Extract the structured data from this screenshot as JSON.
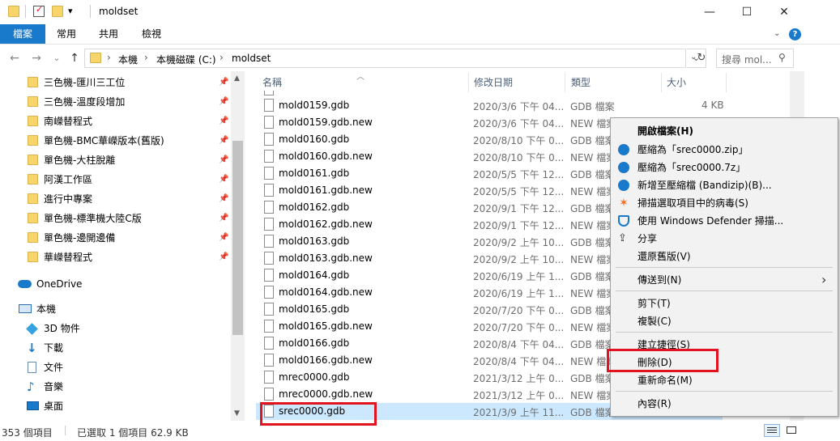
{
  "titlebar": {
    "title": "moldset",
    "qat_dropdown": "▾",
    "minimize": "—",
    "maximize": "☐",
    "close": "✕"
  },
  "ribbon": {
    "tabs": [
      "檔案",
      "常用",
      "共用",
      "檢視"
    ],
    "help": "?"
  },
  "nav": {
    "back": "←",
    "forward": "→",
    "recent": "⌄",
    "up": "↑",
    "breadcrumb": [
      "本機",
      "本機磁碟 (C:)",
      "moldset"
    ],
    "search_placeholder": "搜尋 mol...",
    "refresh": "↻"
  },
  "sidebar": {
    "quick_access": [
      "三色機-匯川三工位",
      "三色機-溫度段增加",
      "南嶸替程式",
      "單色機-BMC華嶸版本(舊版)",
      "單色機-大柱脫離",
      "阿漢工作區",
      "進行中專案",
      "單色機-標準機大陸C版",
      "單色機-邊開邊備",
      "華嶸替程式"
    ],
    "onedrive": "OneDrive",
    "this_pc": "本機",
    "pc_items": [
      "3D 物件",
      "下載",
      "文件",
      "音樂",
      "桌面"
    ]
  },
  "columns": {
    "name": "名稱",
    "date": "修改日期",
    "type": "類型",
    "size": "大小"
  },
  "files": [
    {
      "name": "mold0159.gdb",
      "date": "2020/3/6 下午 04...",
      "type": "GDB 檔案",
      "size": "4 KB"
    },
    {
      "name": "mold0159.gdb.new",
      "date": "2020/3/6 下午 04...",
      "type": "NEW 檔案",
      "size": ""
    },
    {
      "name": "mold0160.gdb",
      "date": "2020/8/10 下午 0...",
      "type": "GDB 檔案",
      "size": ""
    },
    {
      "name": "mold0160.gdb.new",
      "date": "2020/8/10 下午 0...",
      "type": "NEW 檔案",
      "size": ""
    },
    {
      "name": "mold0161.gdb",
      "date": "2020/5/5 下午 12...",
      "type": "GDB 檔案",
      "size": ""
    },
    {
      "name": "mold0161.gdb.new",
      "date": "2020/5/5 下午 12...",
      "type": "NEW 檔案",
      "size": ""
    },
    {
      "name": "mold0162.gdb",
      "date": "2020/9/1 下午 12...",
      "type": "GDB 檔案",
      "size": ""
    },
    {
      "name": "mold0162.gdb.new",
      "date": "2020/9/1 下午 12...",
      "type": "NEW 檔案",
      "size": ""
    },
    {
      "name": "mold0163.gdb",
      "date": "2020/9/2 上午 10...",
      "type": "GDB 檔案",
      "size": ""
    },
    {
      "name": "mold0163.gdb.new",
      "date": "2020/9/2 上午 10...",
      "type": "NEW 檔案",
      "size": ""
    },
    {
      "name": "mold0164.gdb",
      "date": "2020/6/19 上午 1...",
      "type": "GDB 檔案",
      "size": ""
    },
    {
      "name": "mold0164.gdb.new",
      "date": "2020/6/19 上午 1...",
      "type": "NEW 檔案",
      "size": ""
    },
    {
      "name": "mold0165.gdb",
      "date": "2020/7/20 下午 0...",
      "type": "GDB 檔案",
      "size": ""
    },
    {
      "name": "mold0165.gdb.new",
      "date": "2020/7/20 下午 0...",
      "type": "NEW 檔案",
      "size": ""
    },
    {
      "name": "mold0166.gdb",
      "date": "2020/8/4 下午 04...",
      "type": "GDB 檔案",
      "size": ""
    },
    {
      "name": "mold0166.gdb.new",
      "date": "2020/8/4 下午 04...",
      "type": "NEW 檔案",
      "size": ""
    },
    {
      "name": "mrec0000.gdb",
      "date": "2021/3/12 上午 0...",
      "type": "GDB 檔案",
      "size": ""
    },
    {
      "name": "mrec0000.gdb.new",
      "date": "2021/3/12 上午 0...",
      "type": "NEW 檔案",
      "size": ""
    },
    {
      "name": "srec0000.gdb",
      "date": "2021/3/9 上午 11...",
      "type": "GDB 檔案",
      "size": ""
    }
  ],
  "context_menu": {
    "items": [
      "開啟檔案(H)",
      "壓縮為「srec0000.zip」",
      "壓縮為「srec0000.7z」",
      "新增至壓縮檔 (Bandizip)(B)...",
      "掃描選取項目中的病毒(S)",
      "使用 Windows Defender 掃描...",
      "分享",
      "還原舊版(V)",
      "傳送到(N)",
      "剪下(T)",
      "複製(C)",
      "建立捷徑(S)",
      "刪除(D)",
      "重新命名(M)",
      "內容(R)"
    ],
    "submenu_arrow": "›"
  },
  "status": {
    "count": "353 個項目",
    "selected": "已選取 1 個項目 62.9 KB"
  },
  "colors": {
    "accent": "#1979ca",
    "selection": "#cce8ff",
    "highlight_box": "#e0141e"
  }
}
